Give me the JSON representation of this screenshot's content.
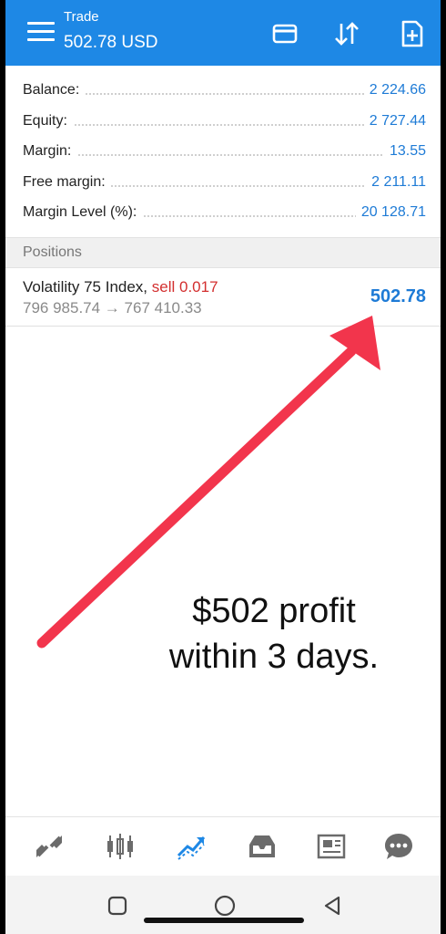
{
  "header": {
    "title": "Trade",
    "subtitle": "502.78 USD"
  },
  "summary": [
    {
      "label": "Balance:",
      "value": "2 224.66"
    },
    {
      "label": "Equity:",
      "value": "2 727.44"
    },
    {
      "label": "Margin:",
      "value": "13.55"
    },
    {
      "label": "Free margin:",
      "value": "2 211.11"
    },
    {
      "label": "Margin Level (%):",
      "value": "20 128.71"
    }
  ],
  "positions": {
    "header": "Positions",
    "items": [
      {
        "symbol": "Volatility 75 Index,",
        "side": "sell 0.017",
        "prices": "796 985.74 → 767 410.33",
        "profit": "502.78"
      }
    ]
  },
  "annotation": {
    "line1": "$502 profit",
    "line2": "within 3 days."
  },
  "bottom_nav": [
    "quotes-icon",
    "chart-icon",
    "trade-icon",
    "history-icon",
    "news-icon",
    "chat-icon"
  ],
  "colors": {
    "appbar": "#1e88e5",
    "value_blue": "#1e7bd6",
    "sell_red": "#d32f2f",
    "arrow_red": "#f2354c"
  }
}
